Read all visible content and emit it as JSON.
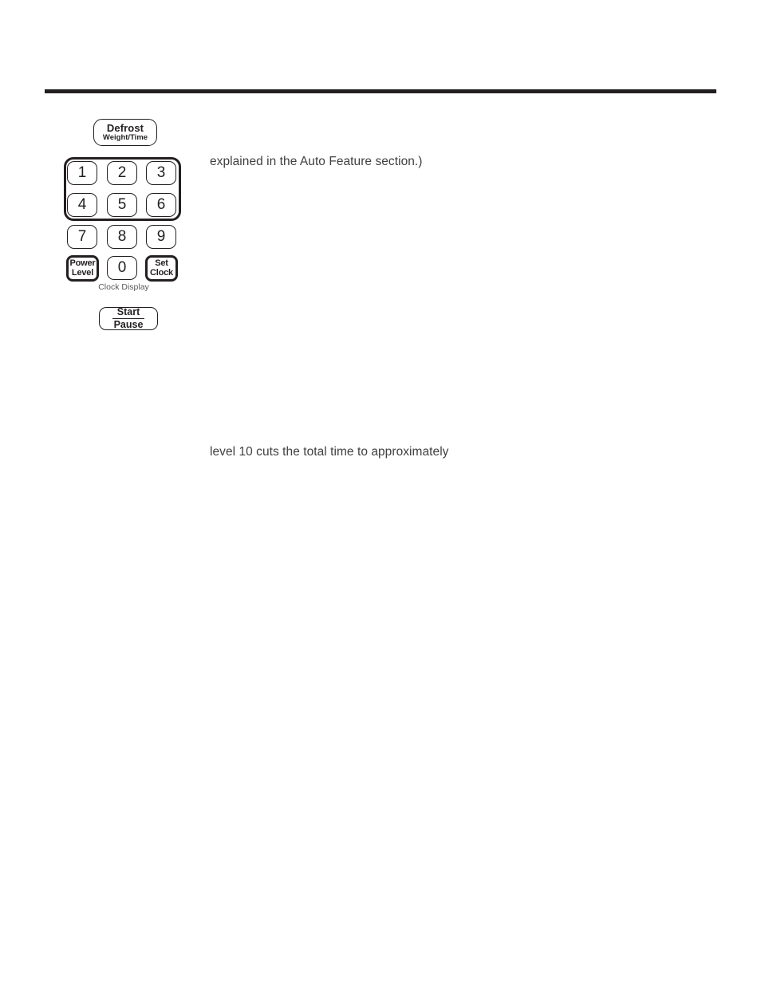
{
  "page": {
    "background": "#ffffff",
    "rule_color": "#231f20",
    "text_color": "#3f3f3f"
  },
  "control_panel": {
    "defrost": {
      "line1": "Defrost",
      "line2": "Weight/Time"
    },
    "number_keys": [
      {
        "label": "1"
      },
      {
        "label": "2"
      },
      {
        "label": "3"
      },
      {
        "label": "4"
      },
      {
        "label": "5"
      },
      {
        "label": "6"
      },
      {
        "label": "7"
      },
      {
        "label": "8"
      },
      {
        "label": "9"
      },
      {
        "label": "0"
      }
    ],
    "power_level": {
      "line1": "Power",
      "line2": "Level"
    },
    "set_clock": {
      "line1": "Set",
      "line2": "Clock"
    },
    "clock_display_label": "Clock Display",
    "start_pause": {
      "line1": "Start",
      "line2": "Pause"
    }
  },
  "content": {
    "paragraph_fragment_1": "explained in the Auto Feature section.)",
    "paragraph_fragment_2": "level 10 cuts the total time to approximately"
  }
}
